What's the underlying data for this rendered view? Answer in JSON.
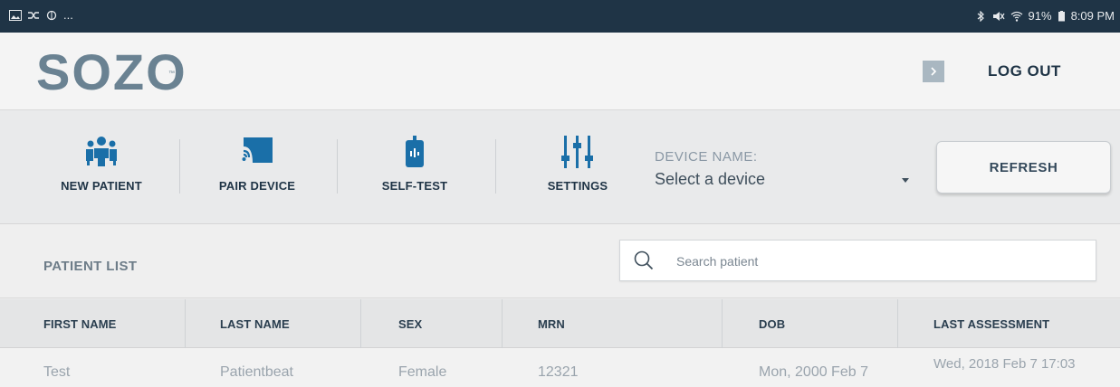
{
  "status_bar": {
    "left_text": "...",
    "right_text": "91%",
    "time": "8:09 PM"
  },
  "header": {
    "logo": "SOZO",
    "trademark": "™",
    "logout_label": "LOG OUT"
  },
  "toolbar": {
    "new_patient_label": "NEW PATIENT",
    "pair_device_label": "PAIR DEVICE",
    "self_test_label": "SELF-TEST",
    "settings_label": "SETTINGS",
    "device_name_label": "DEVICE NAME:",
    "device_select_value": "Select a device",
    "refresh_label": "REFRESH"
  },
  "patient_list": {
    "title": "PATIENT LIST",
    "search_placeholder": "Search patient",
    "columns": [
      "FIRST NAME",
      "LAST NAME",
      "SEX",
      "MRN",
      "DOB",
      "LAST ASSESSMENT"
    ],
    "rows": [
      {
        "first_name": "Test",
        "last_name": "Patientbeat",
        "sex": "Female",
        "mrn": "12321",
        "dob": "Mon, 2000 Feb 7",
        "last_assessment": "Wed, 2018 Feb 7 17:03"
      }
    ]
  },
  "colors": {
    "status_bar_bg": "#1f3446",
    "brand_text": "#6a8292",
    "primary_text": "#1f3446",
    "muted_text": "#9aa4ad"
  }
}
